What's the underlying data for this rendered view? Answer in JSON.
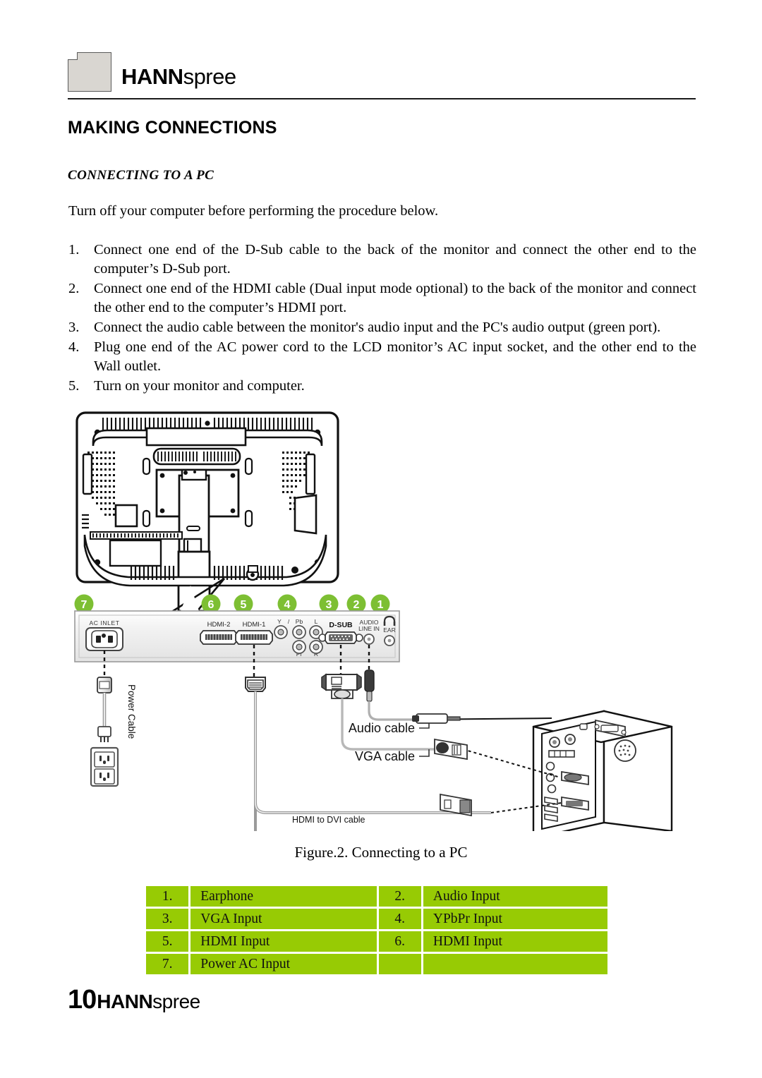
{
  "header": {
    "brand_bold": "HANN",
    "brand_light": "spree",
    "logo_mark": "hannspree-logo-mark"
  },
  "headings": {
    "title": "MAKING CONNECTIONS",
    "subtitle": "CONNECTING TO A PC"
  },
  "body": {
    "intro": "Turn off your computer before performing the procedure below.",
    "steps": [
      {
        "num": "1.",
        "text": "Connect one end of the D-Sub cable to the back of the monitor and connect the other end to the computer’s D-Sub port."
      },
      {
        "num": "2.",
        "text": "Connect one end of the HDMI cable (Dual input mode optional) to the back of the monitor and connect the other end to the computer’s HDMI port."
      },
      {
        "num": "3.",
        "text": "Connect the audio cable between the monitor's audio input and the PC's audio output (green port)."
      },
      {
        "num": "4.",
        "text": "Plug one end of the AC power cord to the LCD monitor’s AC input socket, and the other end to the Wall outlet."
      },
      {
        "num": "5.",
        "text": "Turn on your monitor and computer."
      }
    ]
  },
  "figure": {
    "caption": "Figure.2. Connecting to a PC",
    "callouts": [
      "1",
      "2",
      "3",
      "4",
      "5",
      "6",
      "7"
    ],
    "port_labels": {
      "ac_inlet": "AC INLET",
      "hdmi2": "HDMI-2",
      "hdmi1": "HDMI-1",
      "y": "Y",
      "slash": "/",
      "pb": "Pb",
      "pr": "Pr",
      "l": "L",
      "r": "R",
      "dsub": "D-SUB",
      "audio_line_in_1": "AUDIO",
      "audio_line_in_2": "LINE IN",
      "ear": "EAR"
    },
    "cable_labels": {
      "power": "Power Cable",
      "audio": "Audio cable",
      "vga": "VGA cable",
      "hdmi_dvi": "HDMI to DVI cable"
    }
  },
  "legend_table": {
    "rows": [
      [
        {
          "num": "1.",
          "label": "Earphone"
        },
        {
          "num": "2.",
          "label": "Audio Input"
        }
      ],
      [
        {
          "num": "3.",
          "label": "VGA Input"
        },
        {
          "num": "4.",
          "label": "YPbPr Input"
        }
      ],
      [
        {
          "num": "5.",
          "label": "HDMI Input"
        },
        {
          "num": "6.",
          "label": "HDMI Input"
        }
      ],
      [
        {
          "num": "7.",
          "label": "Power AC Input"
        },
        {
          "num": "",
          "label": ""
        }
      ]
    ]
  },
  "footer": {
    "page_number": "10",
    "brand_bold": "HANN",
    "brand_light": "spree"
  },
  "colors": {
    "table_green": "#97cb04",
    "callout_green": "#7dbf33",
    "logo_gray": "#d9d6d1",
    "rule_black": "#1a1a1a"
  }
}
